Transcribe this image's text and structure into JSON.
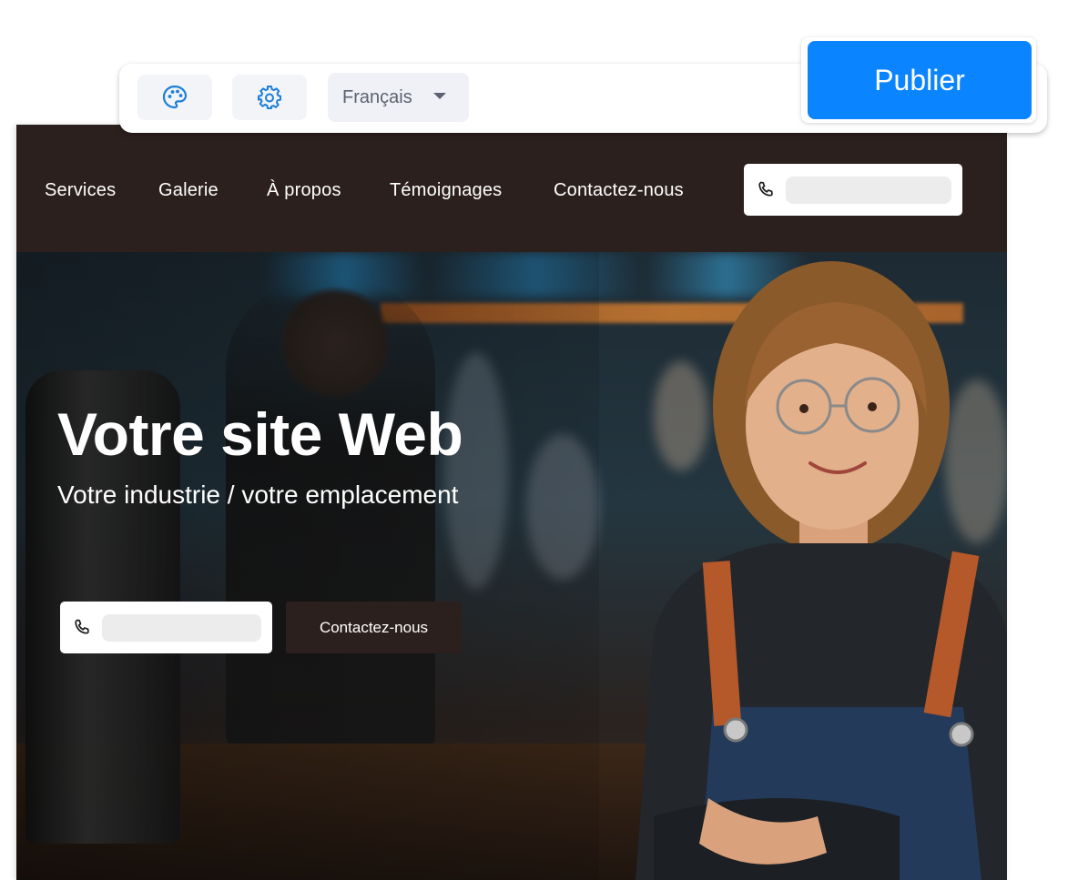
{
  "toolbar": {
    "language": "Français",
    "publish_label": "Publier",
    "icons": [
      "palette-icon",
      "gear-icon",
      "chevron-down-icon"
    ],
    "accent_color": "#0a84ff"
  },
  "site": {
    "nav": {
      "links": [
        {
          "label": "Services"
        },
        {
          "label": "Galerie"
        },
        {
          "label": "À propos"
        },
        {
          "label": "Témoignages"
        },
        {
          "label": "Contactez-nous"
        }
      ],
      "background": "#2b201d"
    },
    "hero": {
      "title": "Votre site Web",
      "subtitle": "Votre industrie / votre emplacement",
      "contact_label": "Contactez-nous"
    }
  }
}
